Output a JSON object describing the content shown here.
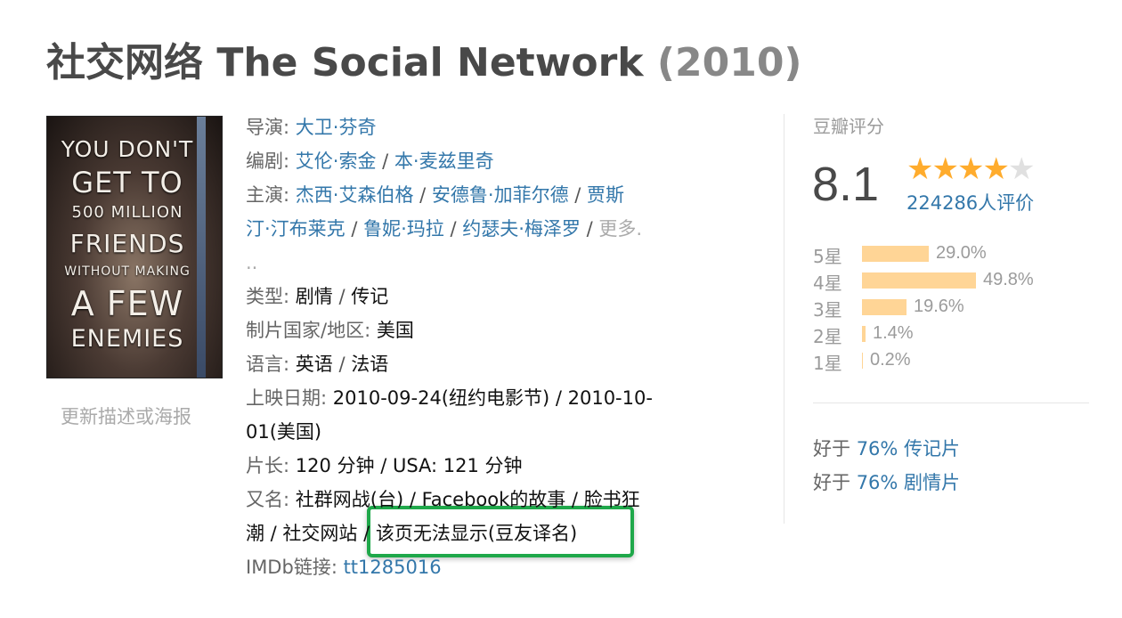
{
  "title": {
    "name": "社交网络 The Social Network",
    "year": "(2010)"
  },
  "poster": {
    "lines": [
      "YOU DON'T",
      "GET TO",
      "500 MILLION",
      "FRIENDS",
      "WITHOUT MAKING",
      "A FEW",
      "ENEMIES"
    ]
  },
  "update_link": "更新描述或海报",
  "info": {
    "director_label": "导演",
    "director": "大卫·芬奇",
    "writer_label": "编剧",
    "writers": [
      "艾伦·索金",
      "本·麦兹里奇"
    ],
    "cast_label": "主演",
    "cast": [
      "杰西·艾森伯格",
      "安德鲁·加菲尔德",
      "贾斯",
      "汀·汀布莱克",
      "鲁妮·玛拉",
      "约瑟夫·梅泽罗"
    ],
    "more": "更多.",
    "more_cont": "..",
    "genre_label": "类型",
    "genres": [
      "剧情",
      "传记"
    ],
    "country_label": "制片国家/地区",
    "country": "美国",
    "language_label": "语言",
    "languages": [
      "英语",
      "法语"
    ],
    "release_label": "上映日期",
    "release_line1": "2010-09-24(纽约电影节) / 2010-10-",
    "release_line2": "01(美国)",
    "runtime_label": "片长",
    "runtime": "120 分钟 / USA: 121 分钟",
    "aka_label": "又名",
    "aka_line1": "社群网战(台) / Facebook的故事 / 脸书狂",
    "aka_line2_prefix": "潮 / 社交网站 / ",
    "aka_highlight": "该页无法显示(豆友译名)",
    "imdb_label": "IMDb链接",
    "imdb": "tt1285016"
  },
  "rating": {
    "title": "豆瓣评分",
    "score": "8.1",
    "stars_value": 4,
    "stars_max": 5,
    "votes": "224286人评价",
    "distribution": [
      {
        "label": "5星",
        "pct": "29.0%",
        "value": 29.0
      },
      {
        "label": "4星",
        "pct": "49.8%",
        "value": 49.8
      },
      {
        "label": "3星",
        "pct": "19.6%",
        "value": 19.6
      },
      {
        "label": "2星",
        "pct": "1.4%",
        "value": 1.4
      },
      {
        "label": "1星",
        "pct": "0.2%",
        "value": 0.2
      }
    ]
  },
  "better_than": [
    {
      "prefix": "好于",
      "value": "76% 传记片"
    },
    {
      "prefix": "好于",
      "value": "76% 剧情片"
    }
  ],
  "colors": {
    "link": "#3377aa",
    "star": "#ffac2d",
    "bar": "#ffd596",
    "highlight_border": "#1fa84a"
  }
}
